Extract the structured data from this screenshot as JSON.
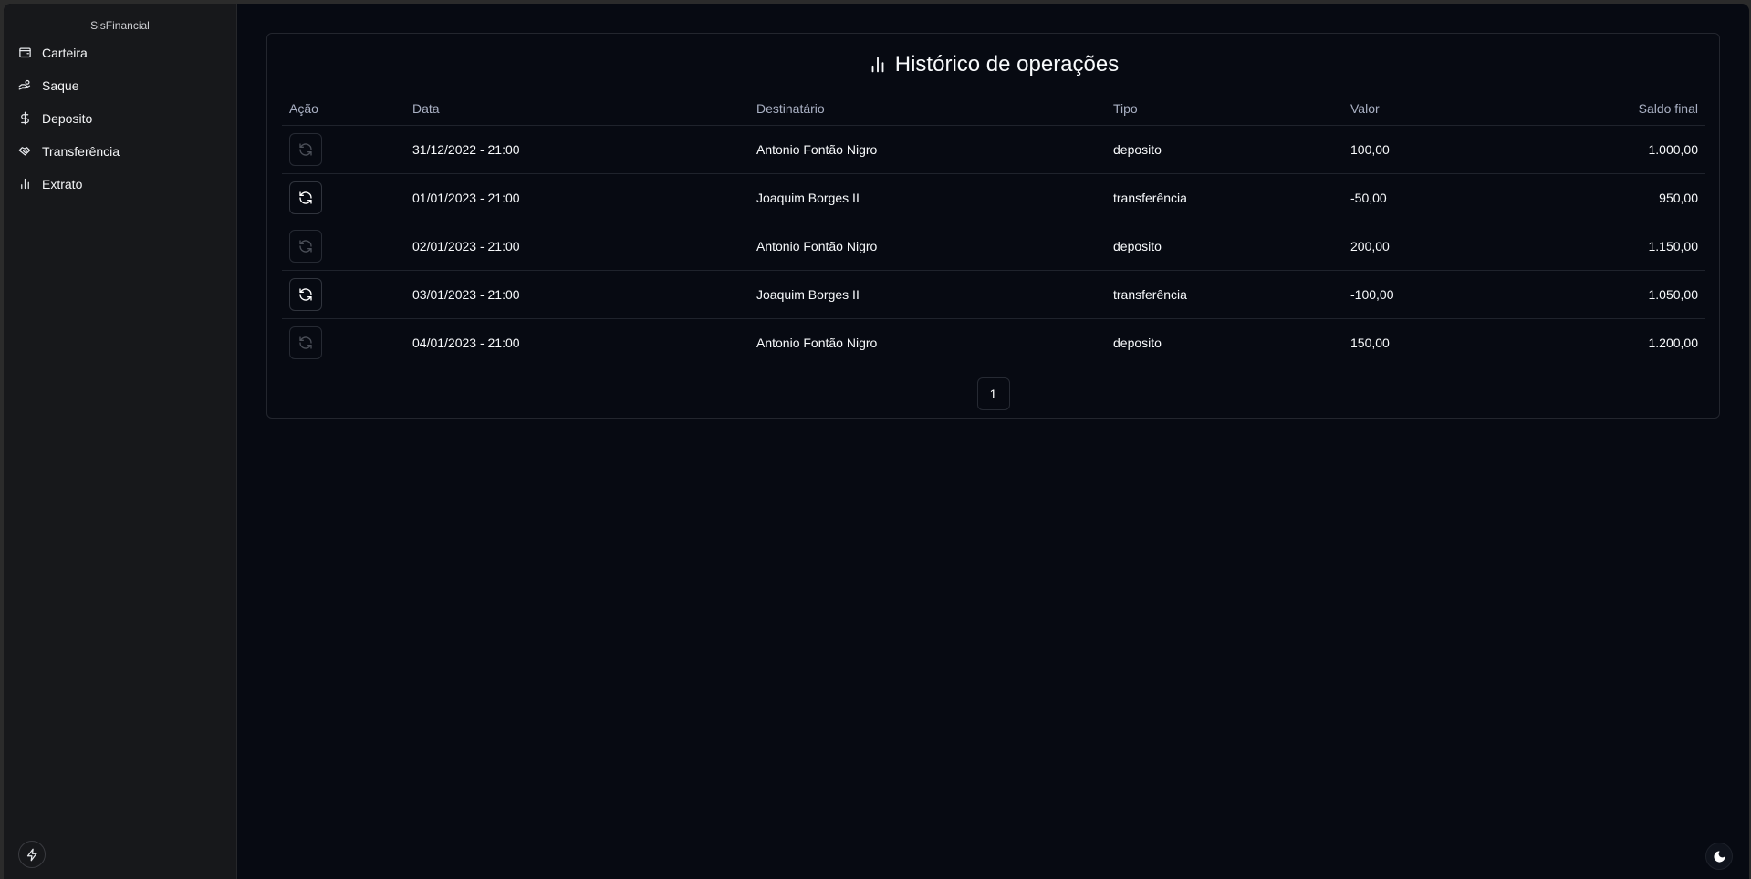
{
  "app": {
    "brand": "SisFinancial"
  },
  "sidebar": {
    "items": [
      {
        "label": "Carteira",
        "icon": "wallet-icon"
      },
      {
        "label": "Saque",
        "icon": "hand-coins-icon"
      },
      {
        "label": "Deposito",
        "icon": "dollar-sign-icon"
      },
      {
        "label": "Transferência",
        "icon": "handshake-icon"
      },
      {
        "label": "Extrato",
        "icon": "bar-chart-icon"
      }
    ],
    "footer_icon": "zap-icon"
  },
  "main": {
    "title": "Histórico de operações",
    "title_icon": "bar-chart-icon",
    "columns": [
      "Ação",
      "Data",
      "Destinatário",
      "Tipo",
      "Valor",
      "Saldo final"
    ],
    "rows": [
      {
        "action_icon": "refresh-icon",
        "action_enabled": false,
        "data": "31/12/2022 - 21:00",
        "destinatario": "Antonio Fontão Nigro",
        "tipo": "deposito",
        "valor": "100,00",
        "saldo": "1.000,00"
      },
      {
        "action_icon": "refresh-icon",
        "action_enabled": true,
        "data": "01/01/2023 - 21:00",
        "destinatario": "Joaquim Borges II",
        "tipo": "transferência",
        "valor": "-50,00",
        "saldo": "950,00"
      },
      {
        "action_icon": "refresh-icon",
        "action_enabled": false,
        "data": "02/01/2023 - 21:00",
        "destinatario": "Antonio Fontão Nigro",
        "tipo": "deposito",
        "valor": "200,00",
        "saldo": "1.150,00"
      },
      {
        "action_icon": "refresh-icon",
        "action_enabled": true,
        "data": "03/01/2023 - 21:00",
        "destinatario": "Joaquim Borges II",
        "tipo": "transferência",
        "valor": "-100,00",
        "saldo": "1.050,00"
      },
      {
        "action_icon": "refresh-icon",
        "action_enabled": false,
        "data": "04/01/2023 - 21:00",
        "destinatario": "Antonio Fontão Nigro",
        "tipo": "deposito",
        "valor": "150,00",
        "saldo": "1.200,00"
      }
    ],
    "pagination": {
      "current_page": "1"
    }
  },
  "theme_toggle_icon": "moon-icon",
  "colors": {
    "background": "#070a12",
    "sidebar": "#17181b",
    "text": "#ffffff",
    "muted": "#a9b0c3"
  }
}
